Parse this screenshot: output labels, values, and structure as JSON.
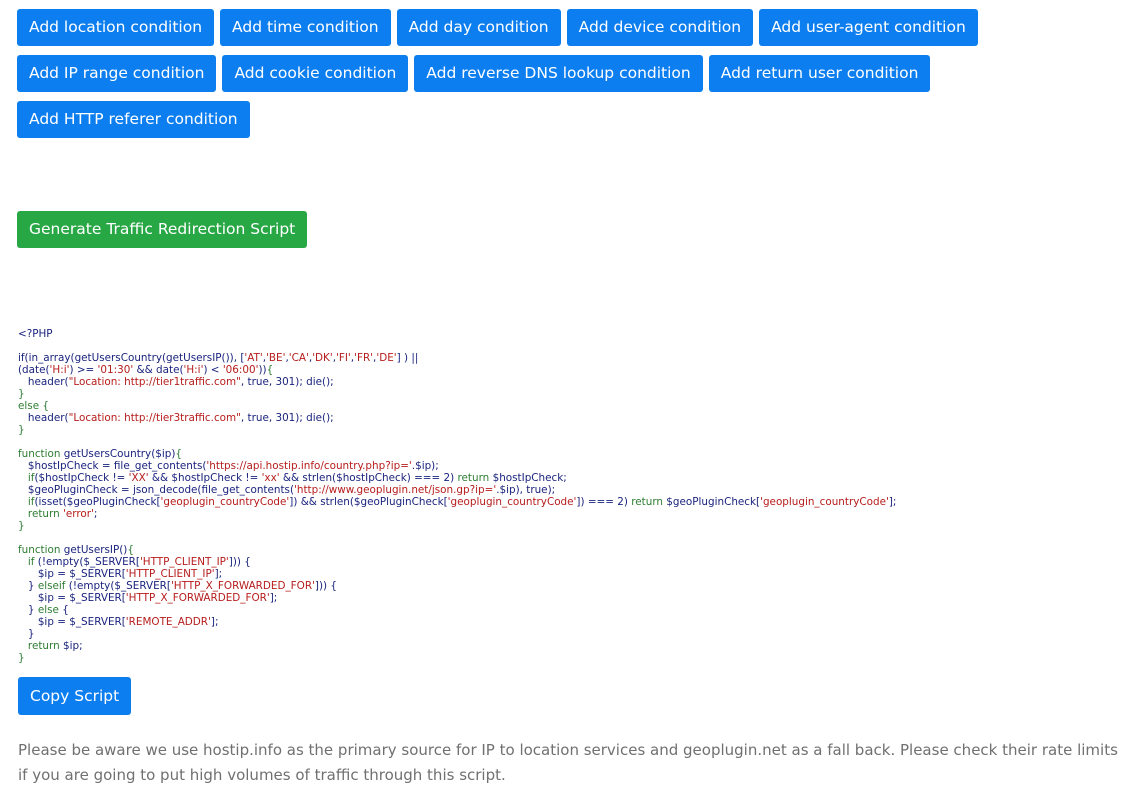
{
  "conditions": [
    [
      "Add location condition",
      "Add time condition",
      "Add day condition",
      "Add device condition",
      "Add user-agent condition"
    ],
    [
      "Add IP range condition",
      "Add cookie condition",
      "Add reverse DNS lookup condition",
      "Add return user condition"
    ],
    [
      "Add HTTP referer condition"
    ]
  ],
  "generate_label": "Generate Traffic Redirection Script",
  "code_lines": [
    [
      [
        "t",
        "<?PHP"
      ]
    ],
    [],
    [
      [
        "t",
        "if(in_array(getUsersCountry(getUsersIP()), ["
      ],
      [
        "s",
        "'AT'"
      ],
      [
        "t",
        ","
      ],
      [
        "s",
        "'BE'"
      ],
      [
        "t",
        ","
      ],
      [
        "s",
        "'CA'"
      ],
      [
        "t",
        ","
      ],
      [
        "s",
        "'DK'"
      ],
      [
        "t",
        ","
      ],
      [
        "s",
        "'FI'"
      ],
      [
        "t",
        ","
      ],
      [
        "s",
        "'FR'"
      ],
      [
        "t",
        ","
      ],
      [
        "s",
        "'DE'"
      ],
      [
        "t",
        "] ) ||"
      ]
    ],
    [
      [
        "t",
        "(date("
      ],
      [
        "s",
        "'H:i'"
      ],
      [
        "t",
        ") >= "
      ],
      [
        "s",
        "'01:30'"
      ],
      [
        "t",
        " && date("
      ],
      [
        "s",
        "'H:i'"
      ],
      [
        "t",
        ") < "
      ],
      [
        "s",
        "'06:00'"
      ],
      [
        "t",
        "))"
      ],
      [
        "k",
        "{"
      ]
    ],
    [
      [
        "t",
        "   header("
      ],
      [
        "s",
        "\"Location: http://tier1traffic.com\""
      ],
      [
        "t",
        ", true, 301); die();"
      ]
    ],
    [
      [
        "k",
        "}"
      ]
    ],
    [
      [
        "k",
        "else {"
      ]
    ],
    [
      [
        "t",
        "   header("
      ],
      [
        "s",
        "\"Location: http://tier3traffic.com\""
      ],
      [
        "t",
        ", true, 301); die();"
      ]
    ],
    [
      [
        "k",
        "}"
      ]
    ],
    [],
    [
      [
        "k",
        "function"
      ],
      [
        "t",
        " getUsersCountry($ip)"
      ],
      [
        "k",
        "{"
      ]
    ],
    [
      [
        "t",
        "   $hostIpCheck = file_get_contents("
      ],
      [
        "s",
        "'https://api.hostip.info/country.php?ip='"
      ],
      [
        "t",
        ".$ip);"
      ]
    ],
    [
      [
        "k",
        "   if"
      ],
      [
        "t",
        "($hostIpCheck != "
      ],
      [
        "s",
        "'XX'"
      ],
      [
        "t",
        " && $hostIpCheck != "
      ],
      [
        "s",
        "'xx'"
      ],
      [
        "t",
        " && strlen($hostIpCheck) === 2) "
      ],
      [
        "k",
        "return"
      ],
      [
        "t",
        " $hostIpCheck;"
      ]
    ],
    [
      [
        "t",
        "   $geoPluginCheck = json_decode(file_get_contents("
      ],
      [
        "s",
        "'http://www.geoplugin.net/json.gp?ip='"
      ],
      [
        "t",
        ".$ip), true);"
      ]
    ],
    [
      [
        "k",
        "   if"
      ],
      [
        "t",
        "(isset($geoPluginCheck["
      ],
      [
        "s",
        "'geoplugin_countryCode'"
      ],
      [
        "t",
        "]) && strlen($geoPluginCheck["
      ],
      [
        "s",
        "'geoplugin_countryCode'"
      ],
      [
        "t",
        "]) === 2) "
      ],
      [
        "k",
        "return"
      ],
      [
        "t",
        " $geoPluginCheck["
      ],
      [
        "s",
        "'geoplugin_countryCode'"
      ],
      [
        "t",
        "];"
      ]
    ],
    [
      [
        "k",
        "   return"
      ],
      [
        "t",
        " "
      ],
      [
        "s",
        "'error'"
      ],
      [
        "t",
        ";"
      ]
    ],
    [
      [
        "k",
        "}"
      ]
    ],
    [],
    [
      [
        "k",
        "function"
      ],
      [
        "t",
        " getUsersIP()"
      ],
      [
        "k",
        "{"
      ]
    ],
    [
      [
        "k",
        "   if"
      ],
      [
        "t",
        " (!empty($_SERVER["
      ],
      [
        "s",
        "'HTTP_CLIENT_IP'"
      ],
      [
        "t",
        "])) {"
      ]
    ],
    [
      [
        "t",
        "      $ip = $_SERVER["
      ],
      [
        "s",
        "'HTTP_CLIENT_IP'"
      ],
      [
        "t",
        "];"
      ]
    ],
    [
      [
        "t",
        "   } "
      ],
      [
        "k",
        "elseif"
      ],
      [
        "t",
        " (!empty($_SERVER["
      ],
      [
        "s",
        "'HTTP_X_FORWARDED_FOR'"
      ],
      [
        "t",
        "])) {"
      ]
    ],
    [
      [
        "t",
        "      $ip = $_SERVER["
      ],
      [
        "s",
        "'HTTP_X_FORWARDED_FOR'"
      ],
      [
        "t",
        "];"
      ]
    ],
    [
      [
        "t",
        "   } "
      ],
      [
        "k",
        "else"
      ],
      [
        "t",
        " {"
      ]
    ],
    [
      [
        "t",
        "      $ip = $_SERVER["
      ],
      [
        "s",
        "'REMOTE_ADDR'"
      ],
      [
        "t",
        "];"
      ]
    ],
    [
      [
        "t",
        "   }"
      ]
    ],
    [
      [
        "k",
        "   return"
      ],
      [
        "t",
        " $ip;"
      ]
    ],
    [
      [
        "k",
        "}"
      ]
    ]
  ],
  "copy_label": "Copy Script",
  "notice": "Please be aware we use hostip.info as the primary source for IP to location services and geoplugin.net as a fall back. Please check their rate limits if you are going to put high volumes of traffic through this script.",
  "colors": {
    "primary_button": "#0d7eef",
    "success_button": "#28a745",
    "code_text": "#1a237e",
    "code_string": "#b71c1c",
    "code_keyword": "#2e7d32",
    "notice_text": "#707070"
  }
}
